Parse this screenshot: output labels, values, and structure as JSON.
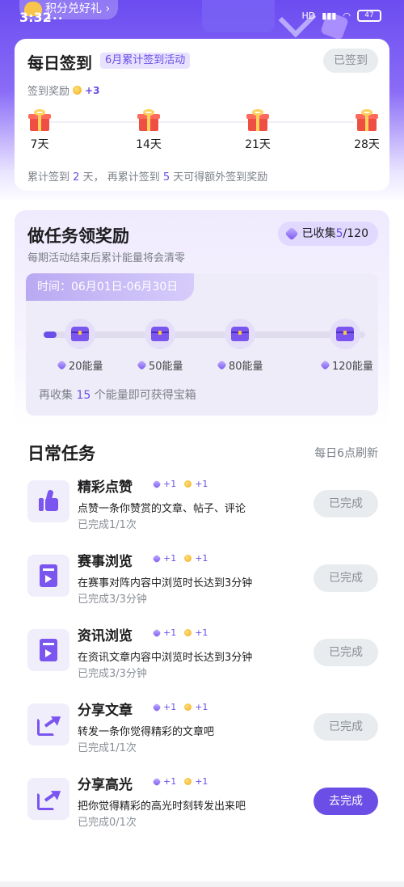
{
  "status": {
    "time": "3:32",
    "battery": "47",
    "net": "HD"
  },
  "header": {
    "points_pill": "积分兑好礼",
    "dots": "•••"
  },
  "signin": {
    "title": "每日签到",
    "badge": "6月累计签到活动",
    "button": "已签到",
    "reward_label": "签到奖励",
    "reward_value": "+3",
    "milestones": [
      "7天",
      "14天",
      "21天",
      "28天"
    ],
    "hint_a": "累计签到",
    "hint_days": "2",
    "hint_b": "天，  再累计签到",
    "hint_more": "5",
    "hint_c": "天可得额外签到奖励"
  },
  "tasks_panel": {
    "title": "做任务领奖励",
    "subtitle": "每期活动结束后累计能量将会清零",
    "collected_prefix": "已收集",
    "collected_num": "5",
    "collected_total": "/120",
    "time_range": "时间：06月01日-06月30日",
    "progress": 0.04,
    "chests": [
      {
        "label": "20能量"
      },
      {
        "label": "50能量"
      },
      {
        "label": "80能量"
      },
      {
        "label": "120能量"
      }
    ],
    "hint_a": "再收集",
    "hint_num": "15",
    "hint_b": "个能量即可获得宝箱"
  },
  "daily": {
    "title": "日常任务",
    "refresh": "每日6点刷新",
    "items": [
      {
        "name": "精彩点赞",
        "gem": "+1",
        "coin": "+1",
        "desc": "点赞一条你赞赏的文章、帖子、评论",
        "progress": "已完成1/1次",
        "button": "已完成",
        "icon": "thumb-up-icon"
      },
      {
        "name": "赛事浏览",
        "gem": "+1",
        "coin": "+1",
        "desc": "在赛事对阵内容中浏览时长达到3分钟",
        "progress": "已完成3/3分钟",
        "button": "已完成",
        "icon": "video-doc-icon"
      },
      {
        "name": "资讯浏览",
        "gem": "+1",
        "coin": "+1",
        "desc": "在资讯文章内容中浏览时长达到3分钟",
        "progress": "已完成3/3分钟",
        "button": "已完成",
        "icon": "video-doc-icon"
      },
      {
        "name": "分享文章",
        "gem": "+1",
        "coin": "+1",
        "desc": "转发一条你觉得精彩的文章吧",
        "progress": "已完成1/1次",
        "button": "已完成",
        "icon": "share-icon"
      },
      {
        "name": "分享高光",
        "gem": "+1",
        "coin": "+1",
        "desc": "把你觉得精彩的高光时刻转发出来吧",
        "progress": "已完成0/1次",
        "button": "去完成",
        "icon": "share-icon"
      }
    ]
  }
}
